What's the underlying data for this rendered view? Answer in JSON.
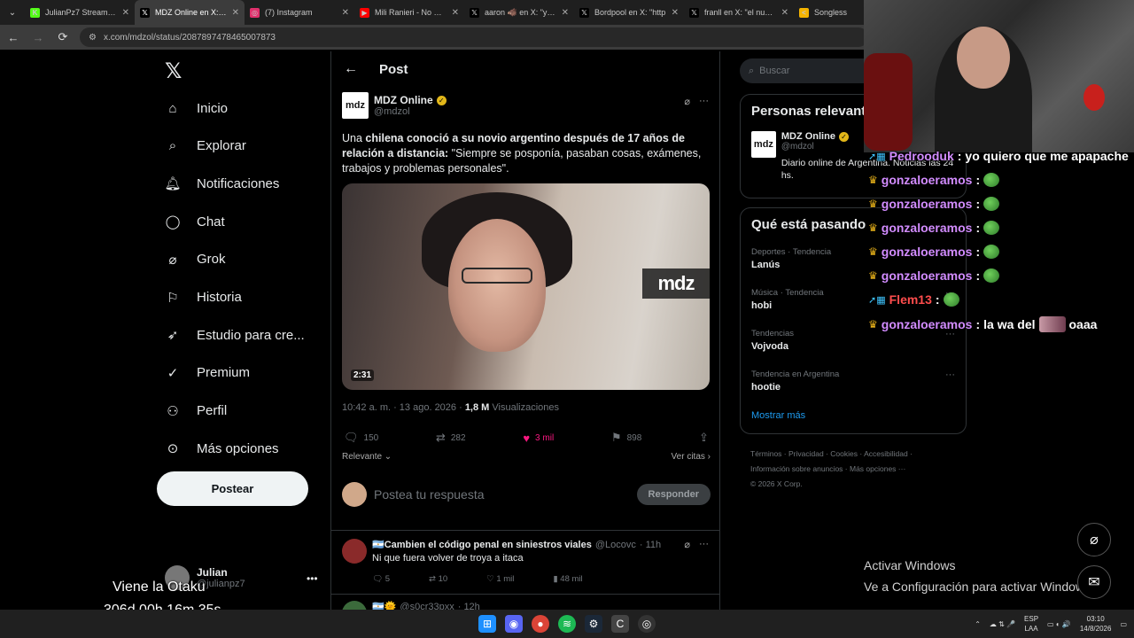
{
  "browser": {
    "tabs": [
      {
        "label": "JulianPz7 Stream - Ki",
        "icon_color": "#53fc18",
        "icon_glyph": "K"
      },
      {
        "label": "MDZ Online en X: \"Un",
        "icon_color": "#000000",
        "icon_glyph": "𝕏",
        "active": true
      },
      {
        "label": "(7) Instagram",
        "icon_color": "#e1306c",
        "icon_glyph": "◎"
      },
      {
        "label": "Mili Ranieri - No Me C",
        "icon_color": "#ff0000",
        "icon_glyph": "▶"
      },
      {
        "label": "aaron 🐗 en X: \"yo lo",
        "icon_color": "#000000",
        "icon_glyph": "𝕏"
      },
      {
        "label": "Bordpool en X: \"http",
        "icon_color": "#000000",
        "icon_glyph": "𝕏"
      },
      {
        "label": "franll en X: \"el nuevo",
        "icon_color": "#000000",
        "icon_glyph": "𝕏"
      },
      {
        "label": "Songless",
        "icon_color": "#f5b400",
        "icon_glyph": "<"
      }
    ],
    "url": "x.com/mdzol/status/2087897478465007873"
  },
  "nav": {
    "items": [
      {
        "label": "Inicio",
        "icon": "home-icon"
      },
      {
        "label": "Explorar",
        "icon": "search-icon"
      },
      {
        "label": "Notificaciones",
        "icon": "bell-icon"
      },
      {
        "label": "Chat",
        "icon": "chat-icon"
      },
      {
        "label": "Grok",
        "icon": "grok-icon"
      },
      {
        "label": "Historia",
        "icon": "bookmark-icon"
      },
      {
        "label": "Estudio para cre...",
        "icon": "rocket-icon"
      },
      {
        "label": "Premium",
        "icon": "premium-icon"
      },
      {
        "label": "Perfil",
        "icon": "person-icon"
      },
      {
        "label": "Más opciones",
        "icon": "more-circle-icon"
      }
    ],
    "post_button": "Postear",
    "account": {
      "name": "Julian",
      "handle": "@julianpz7"
    }
  },
  "main": {
    "header_title": "Post",
    "post": {
      "author_name": "MDZ Online",
      "author_handle": "@mdzol",
      "logo_text": "mdz",
      "text_plain_1": "Una ",
      "text_bold_1": "chilena conoció a su novio argentino después de 17 años de relación a distancia:",
      "text_plain_2": " \"Siempre se posponía, pasaban cosas, exámenes, trabajos y problemas personales\".",
      "media_watermark": "mdz",
      "media_duration": "2:31",
      "timestamp": "10:42 a. m. · 13 ago. 2026 · ",
      "views_count": "1,8 M",
      "views_label": " Visualizaciones",
      "replies": "150",
      "reposts": "282",
      "likes": "3 mil",
      "bookmarks": "898",
      "sort_label": "Relevante",
      "quotes_label": "Ver citas"
    },
    "reply_box": {
      "placeholder": "Postea tu respuesta",
      "button": "Responder"
    },
    "replies": [
      {
        "name": "🇦🇷Cambien el código penal en siniestros viales",
        "handle": "@Locovc",
        "time": "· 11h",
        "text": "Ni que fuera volver de troya a itaca",
        "replies": "5",
        "reposts": "10",
        "likes": "1 mil",
        "views": "48 mil"
      },
      {
        "name": "🇦🇷🌞",
        "handle": "@s0cr33pxx",
        "time": "· 12h"
      }
    ]
  },
  "right": {
    "search_placeholder": "Buscar",
    "people_title": "Personas relevantes",
    "person": {
      "name": "MDZ Online",
      "handle": "@mdzol",
      "bio": "Diario online de Argentina. Noticias las 24 hs."
    },
    "trends_title": "Qué está pasando",
    "trends": [
      {
        "category": "Deportes · Tendencia",
        "name": "Lanús"
      },
      {
        "category": "Música · Tendencia",
        "name": "hobi"
      },
      {
        "category": "Tendencias",
        "name": "Vojvoda"
      },
      {
        "category": "Tendencia en Argentina",
        "name": "hootie"
      }
    ],
    "show_more": "Mostrar más",
    "footer": [
      "Términos",
      "Privacidad",
      "Cookies",
      "Accesibilidad",
      "Información sobre anuncios",
      "Más opciones ···",
      "© 2026 X Corp."
    ]
  },
  "chat": [
    {
      "user": "Pedrooduk",
      "msg": "yo quiero que me apapache",
      "badge": "sub"
    },
    {
      "user": "gonzaloeramos",
      "msg": "",
      "badge": "crown",
      "emote": true
    },
    {
      "user": "gonzaloeramos",
      "msg": "",
      "badge": "crown",
      "emote": true
    },
    {
      "user": "gonzaloeramos",
      "msg": "",
      "badge": "crown",
      "emote": true
    },
    {
      "user": "gonzaloeramos",
      "msg": "",
      "badge": "crown",
      "emote": true
    },
    {
      "user": "gonzaloeramos",
      "msg": "",
      "badge": "crown",
      "emote": true
    },
    {
      "user": "Flem13",
      "msg": "",
      "badge": "sub",
      "emote": true
    },
    {
      "user": "gonzaloeramos",
      "msg": "la wa del",
      "badge": "crown",
      "emote2": true,
      "tail": "oaaa"
    }
  ],
  "overlay": {
    "stream_line_1": "Viene la Otaku",
    "stream_line_2": "306d 00h 16m 35s",
    "activate_title": "Activar Windows",
    "activate_sub": "Ve a Configuración para activar Windows"
  },
  "taskbar": {
    "lang_1": "ESP",
    "lang_2": "LAA",
    "time": "03:10",
    "date": "14/8/2026"
  }
}
